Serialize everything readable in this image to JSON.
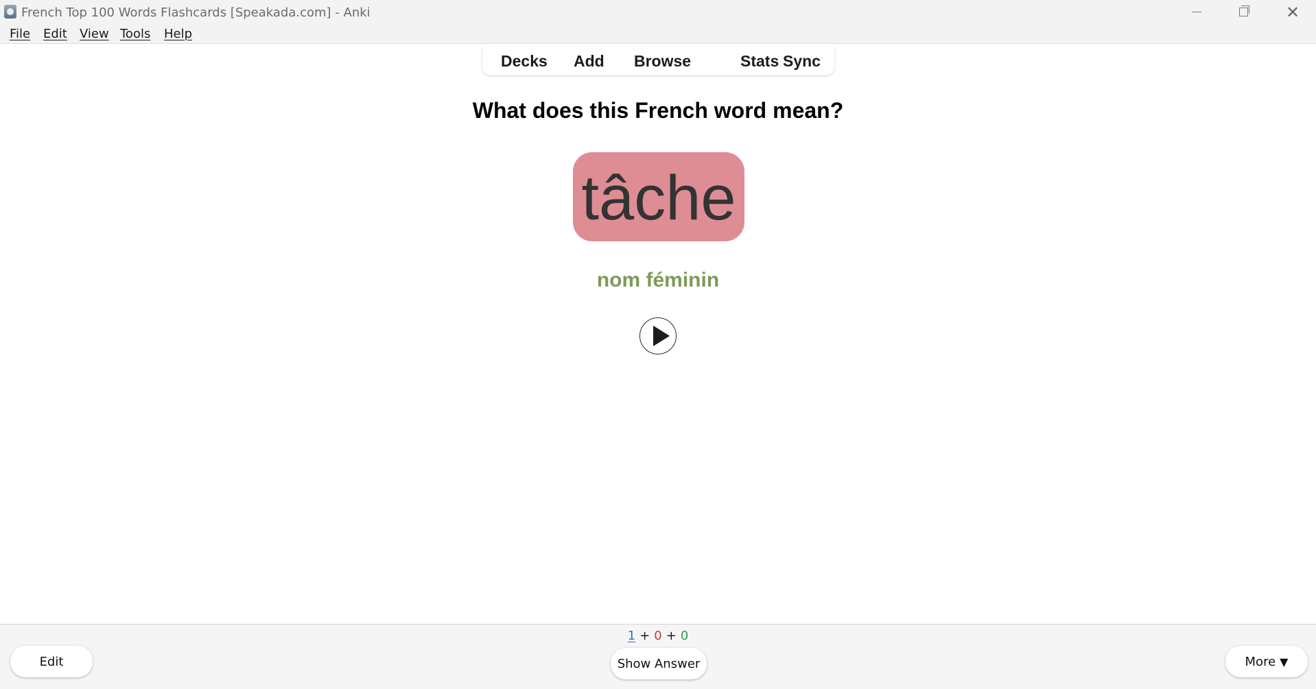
{
  "window": {
    "title": "French Top 100 Words Flashcards [Speakada.com] - Anki",
    "controls": {
      "minimize_icon": "minimize-icon",
      "maximize_icon": "restore-icon",
      "close_icon": "close-icon",
      "close_glyph": "✕"
    }
  },
  "menu": {
    "items": [
      "File",
      "Edit",
      "View",
      "Tools",
      "Help"
    ]
  },
  "toolbar": {
    "links": [
      "Decks",
      "Add",
      "Browse",
      "Stats",
      "Sync"
    ]
  },
  "card": {
    "question": "What does this French word mean?",
    "word": "tâche",
    "part_of_speech": "nom féminin",
    "word_box_color": "#de8d94",
    "pos_color": "#7f9a59",
    "audio_icon": "play-icon"
  },
  "bottom": {
    "counts": {
      "new": "1",
      "learning": "0",
      "review": "0",
      "separator": "+"
    },
    "count_colors": {
      "new": "#3a6fc0",
      "learning": "#c33c3c",
      "review": "#2f9a4a"
    },
    "edit_label": "Edit",
    "show_answer_label": "Show Answer",
    "more_label": "More",
    "more_caret": "▼"
  }
}
